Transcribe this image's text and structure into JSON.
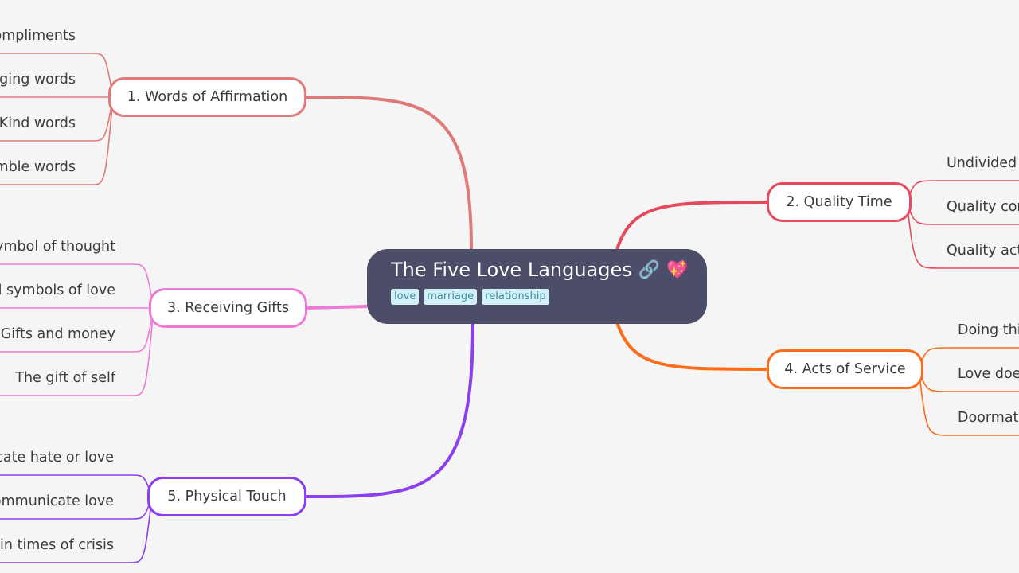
{
  "root": {
    "title": "The Five Love Languages",
    "icons": [
      "link-icon",
      "sparkling-heart-icon"
    ],
    "link_glyph": "🔗",
    "heart_glyph": "💖",
    "tags": [
      "love",
      "marriage",
      "relationship"
    ],
    "background": "#4b4d69"
  },
  "branches": [
    {
      "label": "1. Words of Affirmation",
      "color": "#e07a7a",
      "side": "left",
      "children": [
        "ompliments",
        "aging words",
        "Kind words",
        "mble words"
      ]
    },
    {
      "label": "2. Quality Time",
      "color": "#e5495d",
      "side": "right",
      "children": [
        "Undivided",
        "Quality cor",
        "Quality act"
      ]
    },
    {
      "label": "3. Receiving Gifts",
      "color": "#ef7ad6",
      "side": "left",
      "children": [
        "ymbol of thought",
        "al symbols of love",
        "Gifts and money",
        "The gift of self"
      ]
    },
    {
      "label": "4. Acts of Service",
      "color": "#fb6d1b",
      "side": "right",
      "children": [
        "Doing thi",
        "Love does",
        "Doormat"
      ]
    },
    {
      "label": "5. Physical Touch",
      "color": "#8b3ff0",
      "side": "left",
      "children": [
        "icate hate or love",
        "ommunicate love",
        "n in times of crisis"
      ]
    }
  ]
}
